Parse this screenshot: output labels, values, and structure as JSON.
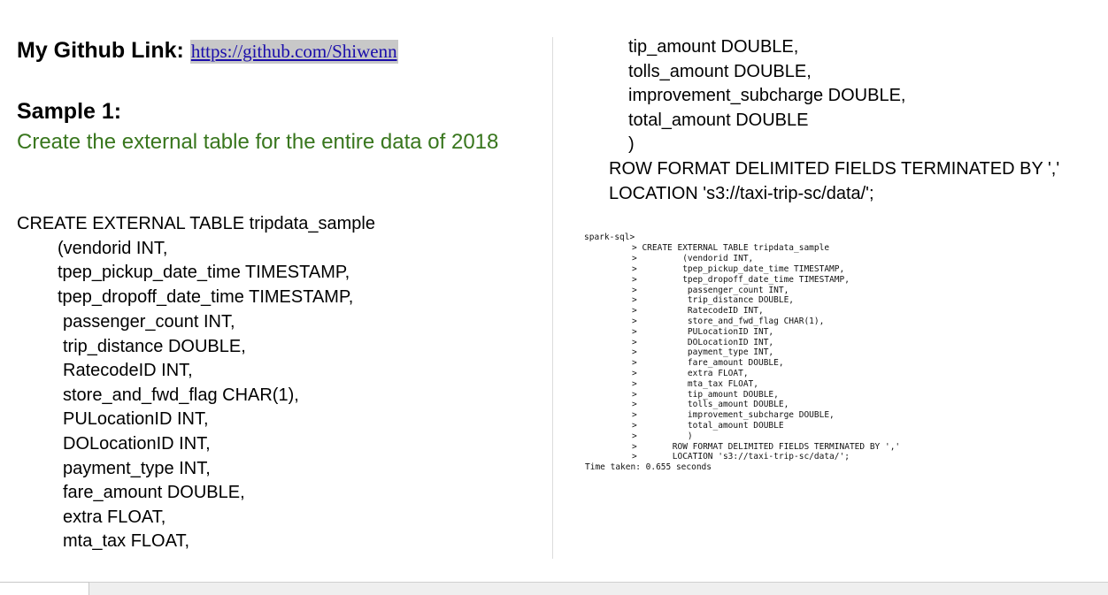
{
  "github": {
    "label": "My Github Link:",
    "url": "https://github.com/Shiwenn"
  },
  "sample": {
    "title": "Sample 1:",
    "description": "Create the external table for the entire data of 2018"
  },
  "left_code": [
    "CREATE EXTERNAL TABLE tripdata_sample",
    "(vendorid INT,",
    "tpep_pickup_date_time TIMESTAMP,",
    "tpep_dropoff_date_time TIMESTAMP,",
    "passenger_count INT,",
    "trip_distance DOUBLE,",
    "RatecodeID INT,",
    "store_and_fwd_flag CHAR(1),",
    "PULocationID INT,",
    "DOLocationID INT,",
    "payment_type INT,",
    "fare_amount DOUBLE,",
    "extra FLOAT,",
    "mta_tax FLOAT,"
  ],
  "right_code": [
    "tip_amount DOUBLE,",
    "tolls_amount DOUBLE,",
    "improvement_subcharge DOUBLE,",
    "total_amount DOUBLE",
    ")",
    "ROW FORMAT DELIMITED FIELDS TERMINATED BY ','",
    "LOCATION 's3://taxi-trip-sc/data/';"
  ],
  "terminal": {
    "prompt": "spark-sql>",
    "lines": [
      "> CREATE EXTERNAL TABLE tripdata_sample",
      ">         (vendorid INT,",
      ">         tpep_pickup_date_time TIMESTAMP,",
      ">         tpep_dropoff_date_time TIMESTAMP,",
      ">          passenger_count INT,",
      ">          trip_distance DOUBLE,",
      ">          RatecodeID INT,",
      ">          store_and_fwd_flag CHAR(1),",
      ">          PULocationID INT,",
      ">          DOLocationID INT,",
      ">          payment_type INT,",
      ">          fare_amount DOUBLE,",
      ">          extra FLOAT,",
      ">          mta_tax FLOAT,",
      ">          tip_amount DOUBLE,",
      ">          tolls_amount DOUBLE,",
      ">          improvement_subcharge DOUBLE,",
      ">          total_amount DOUBLE",
      ">          )",
      ">       ROW FORMAT DELIMITED FIELDS TERMINATED BY ','",
      ">       LOCATION 's3://taxi-trip-sc/data/';"
    ],
    "time_taken": "Time taken: 0.655 seconds"
  }
}
